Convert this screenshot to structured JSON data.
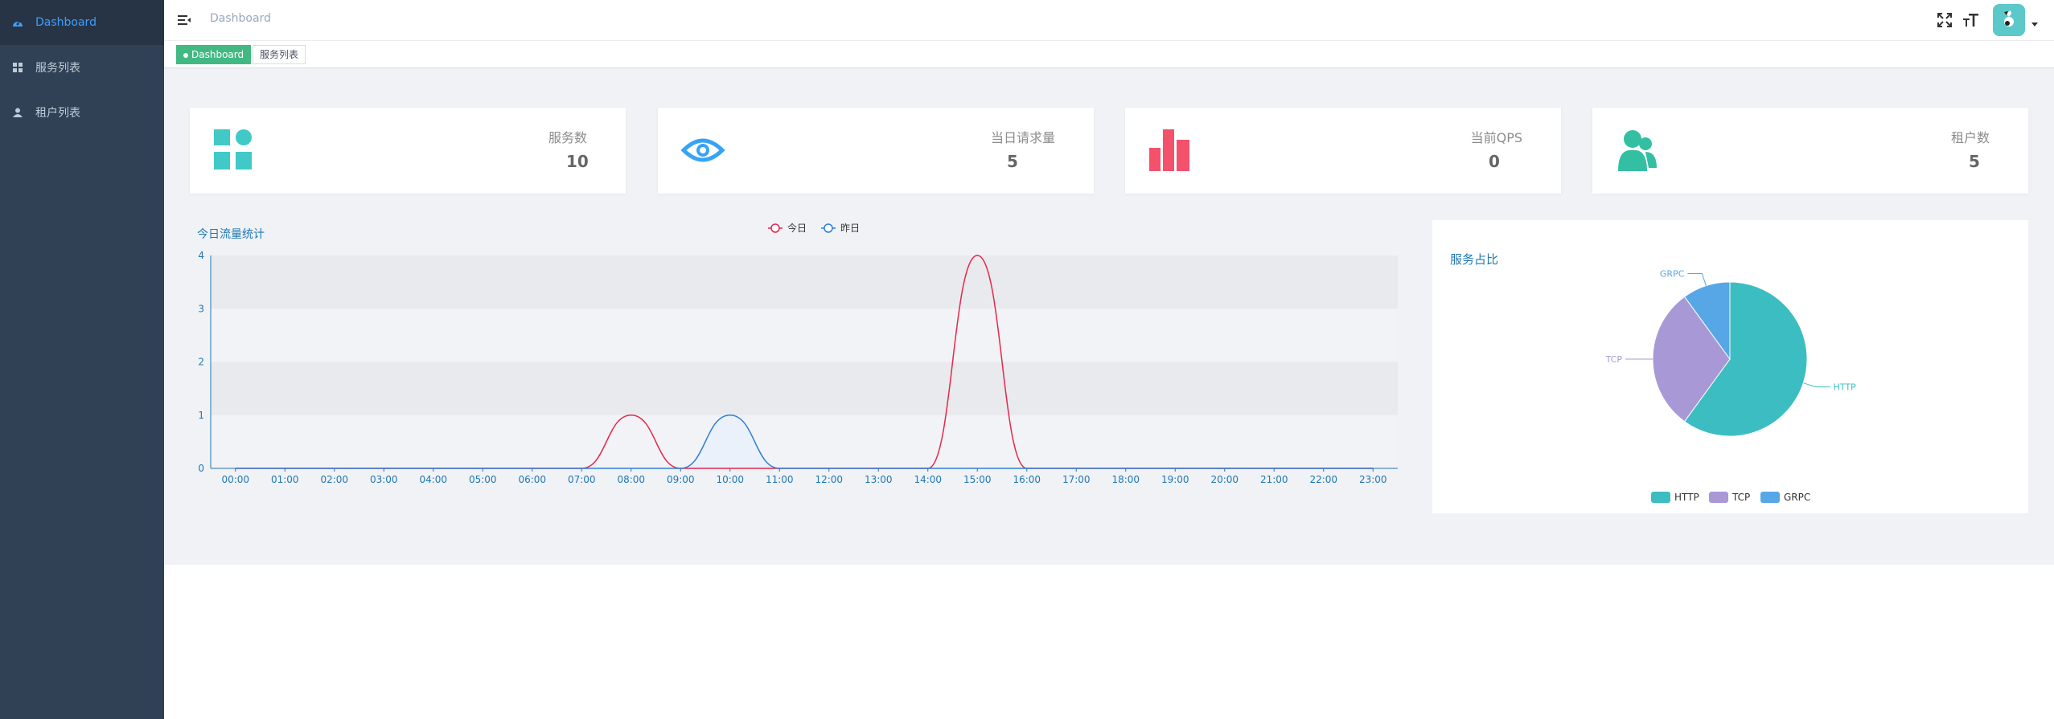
{
  "sidebar": {
    "items": [
      {
        "label": "Dashboard",
        "icon": "dashboard-icon",
        "active": true
      },
      {
        "label": "服务列表",
        "icon": "grid-icon",
        "active": false
      },
      {
        "label": "租户列表",
        "icon": "user-icon",
        "active": false
      }
    ]
  },
  "navbar": {
    "breadcrumb": "Dashboard",
    "icons": [
      "hamburger-icon",
      "fullscreen-icon",
      "font-size-icon",
      "avatar"
    ]
  },
  "tags": {
    "items": [
      {
        "label": "Dashboard",
        "active": true
      },
      {
        "label": "服务列表",
        "active": false
      }
    ]
  },
  "stats": [
    {
      "label": "服务数",
      "value": "10",
      "icon": "grid-icon",
      "color": "#40c9c6"
    },
    {
      "label": "当日请求量",
      "value": "5",
      "icon": "eye-icon",
      "color": "#36a3f7"
    },
    {
      "label": "当前QPS",
      "value": "0",
      "icon": "bar-chart-icon",
      "color": "#f4516c"
    },
    {
      "label": "租户数",
      "value": "5",
      "icon": "users-icon",
      "color": "#34bfa3"
    }
  ],
  "chart_data": [
    {
      "type": "line",
      "title": "今日流量统计",
      "x": [
        "00:00",
        "01:00",
        "02:00",
        "03:00",
        "04:00",
        "05:00",
        "06:00",
        "07:00",
        "08:00",
        "09:00",
        "10:00",
        "11:00",
        "12:00",
        "13:00",
        "14:00",
        "15:00",
        "16:00",
        "17:00",
        "18:00",
        "19:00",
        "20:00",
        "21:00",
        "22:00",
        "23:00"
      ],
      "series": [
        {
          "name": "今日",
          "color": "#e6274c",
          "values": [
            0,
            0,
            0,
            0,
            0,
            0,
            0,
            0,
            1,
            0,
            0,
            0,
            0,
            0,
            0,
            4,
            0,
            0,
            0,
            0,
            0,
            0,
            0,
            0
          ]
        },
        {
          "name": "昨日",
          "color": "#2f7ed8",
          "values": [
            0,
            0,
            0,
            0,
            0,
            0,
            0,
            0,
            0,
            0,
            1,
            0,
            0,
            0,
            0,
            0,
            0,
            0,
            0,
            0,
            0,
            0,
            0,
            0
          ]
        }
      ],
      "yticks": [
        "0",
        "1",
        "2",
        "3",
        "4"
      ],
      "ylim": [
        0,
        4
      ],
      "legend": "top-center"
    },
    {
      "type": "pie",
      "title": "服务占比",
      "categories": [
        "HTTP",
        "TCP",
        "GRPC"
      ],
      "values": [
        6,
        3,
        1
      ],
      "colors": [
        "#3cbdc2",
        "#a899d6",
        "#57a7e6"
      ],
      "legend": "bottom-center"
    }
  ]
}
